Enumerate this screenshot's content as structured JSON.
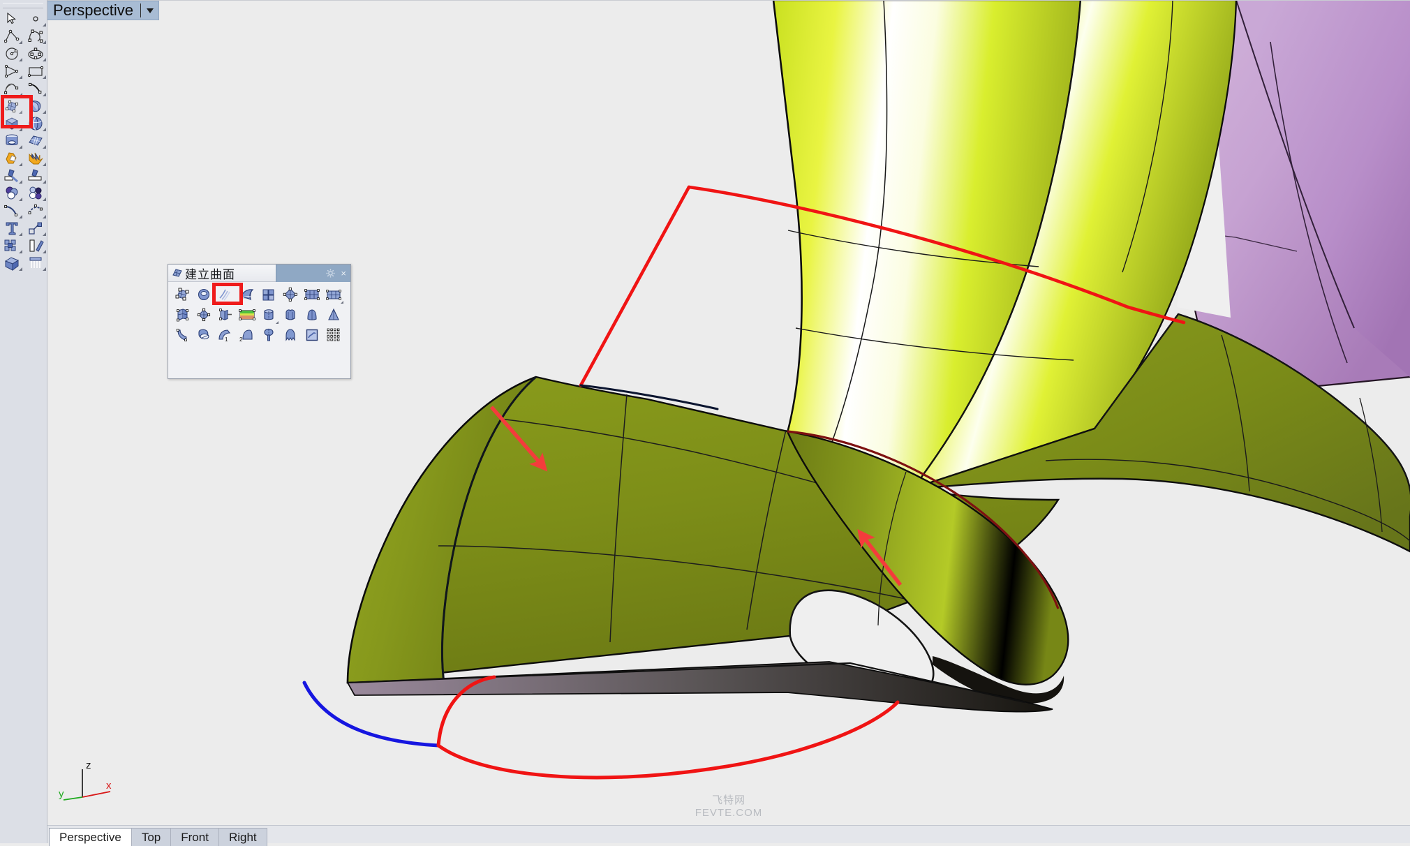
{
  "app": {
    "background_color": "#ececec",
    "accent_highlight_color": "#ef1b1b"
  },
  "viewport": {
    "title": "Perspective",
    "caret_icon": "chevron-down-icon",
    "background_color": "#ececec",
    "title_bg_color": "#a8bcd4"
  },
  "axis_gizmo": {
    "z_label": "z",
    "y_label": "y",
    "x_label": "x",
    "z_color": "#2a2a2a",
    "y_color": "#1faa1f",
    "x_color": "#d81717"
  },
  "watermark": {
    "cn": "飞特网",
    "en": "FEVTE.COM"
  },
  "left_toolbar": {
    "name": "main-tools",
    "highlighted_index": 8,
    "items": [
      {
        "icon": "arrow-select-icon",
        "label": "选取",
        "has_flyout": false
      },
      {
        "icon": "point-icon",
        "label": "点",
        "has_flyout": true
      },
      {
        "icon": "polyline-icon",
        "label": "多重直线",
        "has_flyout": true
      },
      {
        "icon": "control-point-curve-icon",
        "label": "控制点曲线",
        "has_flyout": true
      },
      {
        "icon": "circle-icon",
        "label": "圆",
        "has_flyout": true
      },
      {
        "icon": "ellipse-icon",
        "label": "椭圆",
        "has_flyout": true
      },
      {
        "icon": "polygon-icon",
        "label": "多边形",
        "has_flyout": true
      },
      {
        "icon": "rectangle-icon",
        "label": "矩形",
        "has_flyout": true
      },
      {
        "icon": "arc-icon",
        "label": "弧",
        "has_flyout": true
      },
      {
        "icon": "free-curve-icon",
        "label": "自由造形",
        "has_flyout": true
      },
      {
        "icon": "surface-from-points-icon",
        "label": "建立曲面",
        "has_flyout": true
      },
      {
        "icon": "extrude-surface-icon",
        "label": "挤出曲面",
        "has_flyout": true
      },
      {
        "icon": "box-solid-icon",
        "label": "实体方块",
        "has_flyout": true
      },
      {
        "icon": "sphere-solid-icon",
        "label": "球体",
        "has_flyout": true
      },
      {
        "icon": "cylinder-solid-icon",
        "label": "圆柱体",
        "has_flyout": true
      },
      {
        "icon": "mesh-icon",
        "label": "网格",
        "has_flyout": true
      },
      {
        "icon": "boolean-union-icon",
        "label": "布尔运算联集",
        "has_flyout": true
      },
      {
        "icon": "explode-icon",
        "label": "炸开",
        "has_flyout": true
      },
      {
        "icon": "trim-icon",
        "label": "修剪",
        "has_flyout": true
      },
      {
        "icon": "split-icon",
        "label": "分割",
        "has_flyout": true
      },
      {
        "icon": "boolean-difference-icon",
        "label": "布尔运算差集",
        "has_flyout": true
      },
      {
        "icon": "boolean-intersect-icon",
        "label": "布尔运算交集",
        "has_flyout": true
      },
      {
        "icon": "fillet-curve-icon",
        "label": "圆角",
        "has_flyout": true
      },
      {
        "icon": "blend-curve-icon",
        "label": "混接曲线",
        "has_flyout": true
      },
      {
        "icon": "text-icon",
        "label": "文字",
        "has_flyout": true
      },
      {
        "icon": "scale-icon",
        "label": "缩放",
        "has_flyout": true
      },
      {
        "icon": "array-icon",
        "label": "阵列",
        "has_flyout": true
      },
      {
        "icon": "mirror-icon",
        "label": "镜射",
        "has_flyout": true
      },
      {
        "icon": "render-icon",
        "label": "彩现",
        "has_flyout": true
      },
      {
        "icon": "lights-icon",
        "label": "灯光",
        "has_flyout": true
      }
    ]
  },
  "surface_palette": {
    "title": "建立曲面",
    "title_icon": "surface-palette-icon",
    "gear_icon": "gear-icon",
    "close_icon": "close-icon",
    "close_label": "×",
    "highlighted_index": 3,
    "rows": [
      [
        {
          "icon": "surface-from-points-icon",
          "label": "以二、三或四个边缘曲线建立曲面",
          "has_flyout": false
        },
        {
          "icon": "surface-from-planar-curves-icon",
          "label": "以平面曲线建立曲面",
          "has_flyout": false
        },
        {
          "icon": "surface-from-network-icon",
          "label": "从网线建立曲面",
          "has_flyout": false
        },
        {
          "icon": "patch-surface-icon",
          "label": "嵌面",
          "has_flyout": false
        },
        {
          "icon": "corner-point-surface-icon",
          "label": "以三或四个角建立曲面",
          "has_flyout": false
        },
        {
          "icon": "drape-surface-icon",
          "label": "布帘曲面",
          "has_flyout": false
        },
        {
          "icon": "surface-from-grid-icon",
          "label": "从点格建立曲面",
          "has_flyout": false
        },
        {
          "icon": "surface-from-grid2-icon",
          "label": "从点格建立曲面 2",
          "has_flyout": true
        }
      ],
      [
        {
          "icon": "extrude-straight-icon",
          "label": "直线挤出",
          "has_flyout": false
        },
        {
          "icon": "extrude-point-icon",
          "label": "挤出至点",
          "has_flyout": false
        },
        {
          "icon": "extrude-tapered-icon",
          "label": "沿着曲线挤出",
          "has_flyout": false
        },
        {
          "icon": "heightfield-icon",
          "label": "以图片灰阶高度建立曲面",
          "has_flyout": false
        },
        {
          "icon": "revolve-icon",
          "label": "旋转成形",
          "has_flyout": true
        },
        {
          "icon": "rail-revolve-icon",
          "label": "沿着路径旋转",
          "has_flyout": false
        },
        {
          "icon": "loft-icon",
          "label": "放样",
          "has_flyout": false
        },
        {
          "icon": "cone-icon",
          "label": "圆锥曲面",
          "has_flyout": false
        }
      ],
      [
        {
          "icon": "sweep1-icon",
          "label": "单轨扫掠",
          "has_flyout": false
        },
        {
          "icon": "sweep2-icon",
          "label": "双轨扫掠",
          "has_flyout": false
        },
        {
          "icon": "blend-surface-1-icon",
          "label": "混接曲面 1",
          "label_badge": "1",
          "has_flyout": false
        },
        {
          "icon": "blend-surface-2-icon",
          "label": "混接曲面 2",
          "label_badge": "2",
          "has_flyout": false
        },
        {
          "icon": "fillet-surface-icon",
          "label": "曲面圆角",
          "has_flyout": false
        },
        {
          "icon": "offset-surface-icon",
          "label": "偏移曲面",
          "has_flyout": false
        },
        {
          "icon": "picture-frame-icon",
          "label": "图框",
          "has_flyout": false
        },
        {
          "icon": "point-grid-icon",
          "label": "点格",
          "has_flyout": false
        }
      ]
    ]
  },
  "bottom_tabs": [
    {
      "label": "Perspective",
      "active": true
    },
    {
      "label": "Top",
      "active": false
    },
    {
      "label": "Front",
      "active": false
    },
    {
      "label": "Right",
      "active": false
    }
  ],
  "scene": {
    "description": "3D NURBS surface model in Rhino viewport",
    "surfaces": [
      {
        "name": "green-swept-surface",
        "color_light": "#ffffff",
        "color_mid": "#d6ec26",
        "color_dark": "#7c8c18"
      },
      {
        "name": "purple-surface",
        "color_light": "#c8a6d2",
        "color_dark": "#9e72ad"
      },
      {
        "name": "olive-lower-surface",
        "color": "#7f9019"
      }
    ],
    "curves": [
      {
        "name": "red-boundary-curve-top",
        "color": "#f01414"
      },
      {
        "name": "red-boundary-curve-bottom",
        "color": "#f01414"
      },
      {
        "name": "blue-curve",
        "color": "#1616e0"
      },
      {
        "name": "dark-red-edge-curve",
        "color": "#8a1010"
      }
    ],
    "annotations": [
      {
        "name": "red-arrow-upper-left",
        "color": "#f43c3c"
      },
      {
        "name": "red-arrow-lower-middle",
        "color": "#f43c3c"
      }
    ]
  }
}
